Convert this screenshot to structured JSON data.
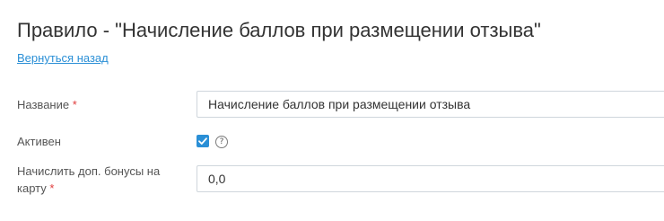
{
  "page": {
    "title": "Правило - \"Начисление баллов при размещении отзыва\"",
    "back_link": "Вернуться назад"
  },
  "form": {
    "name": {
      "label": "Название",
      "required_mark": "*",
      "value": "Начисление баллов при размещении отзыва"
    },
    "active": {
      "label": "Активен",
      "checked": true,
      "help_icon": "question-circle-icon",
      "help_glyph": "?"
    },
    "bonus": {
      "label": "Начислить доп. бонусы на карту",
      "required_mark": "*",
      "value": "0,0"
    }
  },
  "colors": {
    "accent": "#2a8fd6",
    "required": "#e03c3c",
    "text": "#333333",
    "border": "#cfd6dc"
  }
}
